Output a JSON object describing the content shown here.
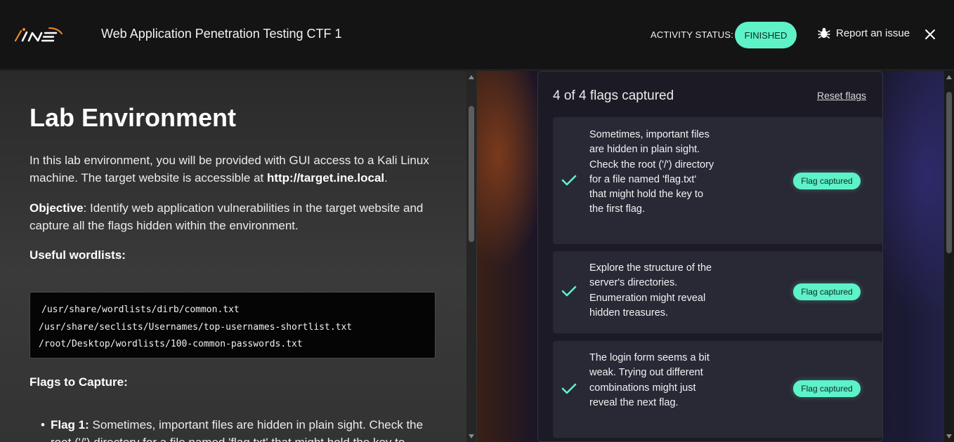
{
  "header": {
    "logo_text": "INE",
    "title": "Web Application Penetration Testing CTF 1",
    "activity_status_label": "ACTIVITY STATUS:",
    "activity_status_value": "FINISHED",
    "report_issue_label": "Report an issue",
    "icons": [
      "ine-logo-icon",
      "bug-icon",
      "close-icon"
    ]
  },
  "lab": {
    "heading": "Lab Environment",
    "intro_prefix": "In this lab environment, you will be provided with GUI access to a Kali Linux machine. The target website is accessible at ",
    "target_url": "http://target.ine.local",
    "intro_suffix": ".",
    "objective_label": "Objective",
    "objective_text": ": Identify web application vulnerabilities in the target website and capture all the flags hidden within the environment.",
    "wordlists_heading": "Useful wordlists:",
    "wordlists": [
      "/usr/share/wordlists/dirb/common.txt",
      "/usr/share/seclists/Usernames/top-usernames-shortlist.txt",
      "/root/Desktop/wordlists/100-common-passwords.txt"
    ],
    "flags_heading": "Flags to Capture:",
    "flag1_label": "Flag 1:",
    "flag1_text": " Sometimes, important files are hidden in plain sight. Check the root ('/') directory for a file named 'flag.txt' that might hold the key to"
  },
  "flags_panel": {
    "summary": "4 of 4 flags captured",
    "reset_label": "Reset flags",
    "items": [
      {
        "text": "Sometimes, important files are hidden in plain sight. Check the root ('/') directory for a file named 'flag.txt' that might hold the key to the first flag.",
        "status": "Flag captured"
      },
      {
        "text": "Explore the structure of the server's directories. Enumeration might reveal hidden treasures.",
        "status": "Flag captured"
      },
      {
        "text": "The login form seems a bit weak. Trying out different combinations might just reveal the next flag.",
        "status": "Flag captured"
      }
    ]
  },
  "colors": {
    "accent": "#5ef2c8",
    "logo_orange": "#f08a24",
    "topbar_bg": "#141414",
    "panel_bg": "#1c1b25",
    "card_bg": "#292835"
  }
}
